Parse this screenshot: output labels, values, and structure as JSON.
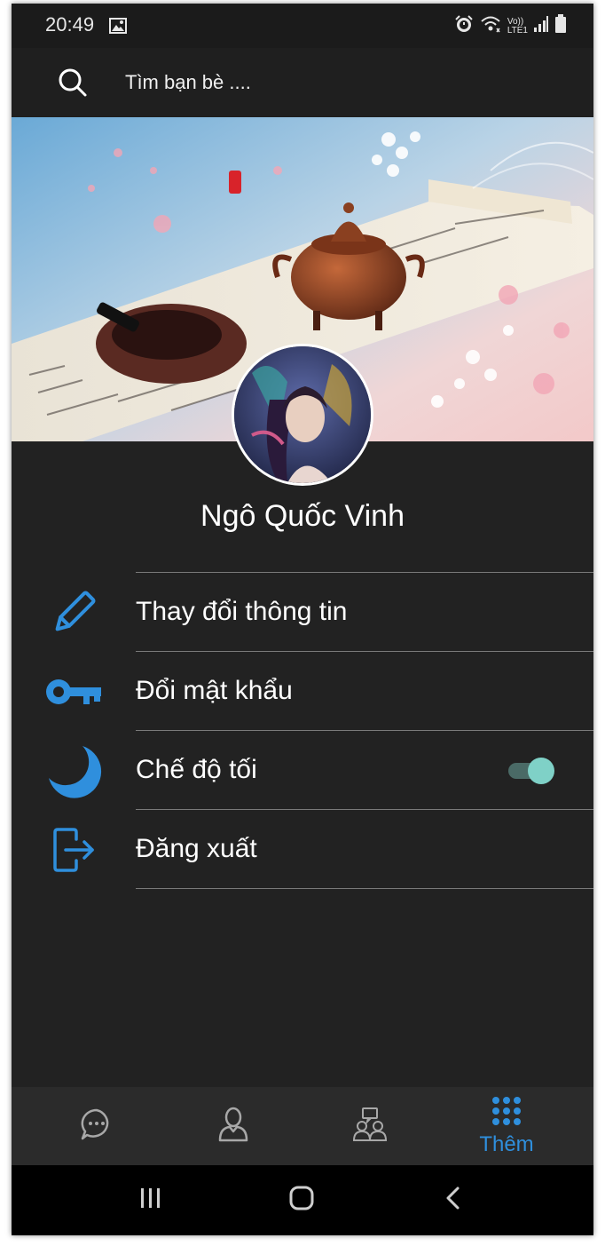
{
  "status_bar": {
    "time": "20:49",
    "icons": [
      "image-icon",
      "alarm-icon",
      "wifi-icon",
      "volte-lte-icon",
      "signal-icon",
      "battery-icon"
    ],
    "network_label_top": "Vo))",
    "network_label_bottom": "LTE1"
  },
  "search": {
    "icon": "search-icon",
    "placeholder": "Tìm bạn bè ...."
  },
  "profile": {
    "name": "Ngô Quốc Vinh"
  },
  "menu": {
    "items": [
      {
        "label": "Thay đổi thông tin",
        "icon": "pencil-icon"
      },
      {
        "label": "Đổi mật khẩu",
        "icon": "key-icon"
      },
      {
        "label": "Chế độ tối",
        "icon": "moon-icon",
        "toggle_on": true
      },
      {
        "label": "Đăng xuất",
        "icon": "logout-icon"
      }
    ]
  },
  "bottom_nav": {
    "items": [
      {
        "icon": "chat-bubble-icon",
        "label": ""
      },
      {
        "icon": "contact-icon",
        "label": ""
      },
      {
        "icon": "group-icon",
        "label": ""
      },
      {
        "icon": "grid-dots-icon",
        "label": "Thêm",
        "active": true
      }
    ]
  },
  "colors": {
    "accent": "#2f8fdd",
    "background": "#222222",
    "toggle_thumb": "#7fd1c7"
  }
}
